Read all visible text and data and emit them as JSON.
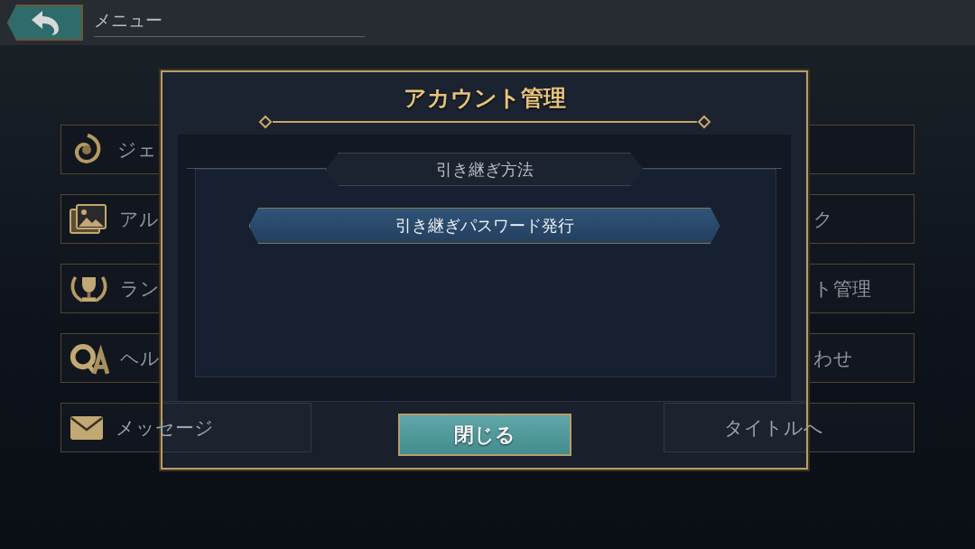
{
  "header": {
    "title": "メニュー"
  },
  "menu_rows": [
    {
      "left": "ジェ"
    },
    {
      "left": "アル",
      "right": "ク"
    },
    {
      "left": "ラン",
      "right": "ト管理"
    },
    {
      "left": "ヘル",
      "right": "わせ"
    },
    {
      "left": "メッセージ",
      "right": "タイトルへ"
    }
  ],
  "dialog": {
    "title": "アカウント管理",
    "section": "引き継ぎ方法",
    "options": [
      "引き継ぎパスワード発行"
    ],
    "close": "閉じる"
  }
}
